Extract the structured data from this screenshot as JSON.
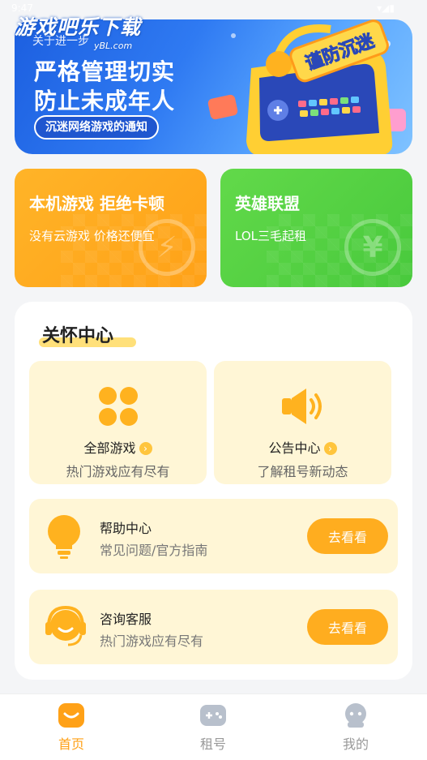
{
  "status_bar": {
    "time": "9:47",
    "icons": "▾◢▮"
  },
  "watermark": {
    "title": "游戏吧乐下载",
    "sub": "yBL.com"
  },
  "banner": {
    "top_text": "关于进一步",
    "line1": "严格管理切实",
    "line2": "防止未成年人",
    "pill": "沉迷网络游戏的通知",
    "badge": "谨防沉迷"
  },
  "promos": [
    {
      "title": "本机游戏 拒绝卡顿",
      "subtitle": "没有云游戏 价格还便宜",
      "icon": "lightning-icon"
    },
    {
      "title": "英雄联盟",
      "subtitle": "LOL三毛起租",
      "icon": "yen-icon"
    }
  ],
  "care_center": {
    "title": "关怀中心",
    "tiles": [
      {
        "label": "全部游戏",
        "desc": "热门游戏应有尽有",
        "icon": "grid-icon"
      },
      {
        "label": "公告中心",
        "desc": "了解租号新动态",
        "icon": "speaker-icon"
      }
    ],
    "rows": [
      {
        "title": "帮助中心",
        "subtitle": "常见问题/官方指南",
        "button": "去看看",
        "icon": "lightbulb-icon"
      },
      {
        "title": "咨询客服",
        "subtitle": "热门游戏应有尽有",
        "button": "去看看",
        "icon": "headset-icon"
      }
    ]
  },
  "tabbar": {
    "items": [
      {
        "label": "首页",
        "active": true
      },
      {
        "label": "租号",
        "active": false
      },
      {
        "label": "我的",
        "active": false
      }
    ]
  },
  "colors": {
    "accent": "#ffa117",
    "green": "#52d142",
    "blue": "#2f7af2",
    "tile_bg": "#fff6d6"
  }
}
